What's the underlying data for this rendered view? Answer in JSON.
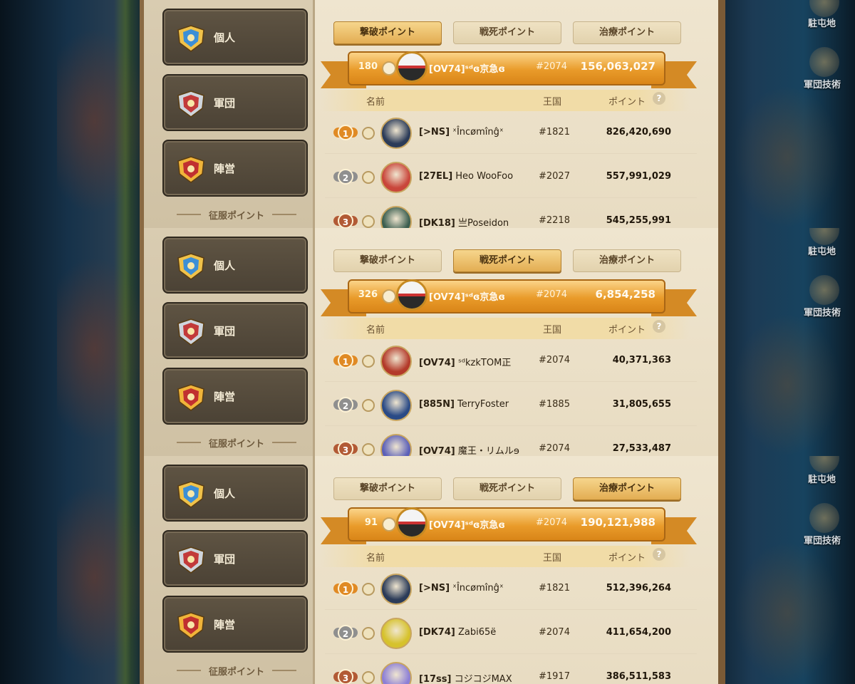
{
  "categories": [
    "個人",
    "軍団",
    "陣営"
  ],
  "conquest_label": "征服ポイント",
  "tabs": [
    "撃破ポイント",
    "戦死ポイント",
    "治療ポイント"
  ],
  "headers": {
    "name": "名前",
    "kingdom": "王国",
    "points": "ポイント",
    "help": "?"
  },
  "side_labels": {
    "camp": "駐屯地",
    "tech": "軍団技術"
  },
  "colors": {
    "gold": "#e99b2a",
    "silver": "#9a9a9a",
    "bronze": "#b25a35",
    "active_tab": "#e3ad52"
  },
  "panels": [
    {
      "active_tab": 0,
      "self": {
        "rank": "180",
        "name": "[OV74]ˢᵈɞ京急ɞ",
        "kingdom": "#2074",
        "points": "156,063,027"
      },
      "rows": [
        {
          "rank": "1",
          "tag": "[>NS]",
          "player": "ˣÎncømînĝˣ",
          "kingdom": "#1821",
          "points": "826,420,690",
          "avatar_color": "#2b3b58"
        },
        {
          "rank": "2",
          "tag": "[27EL]",
          "player": "Heo WooFoo",
          "kingdom": "#2027",
          "points": "557,991,029",
          "avatar_color": "#c9463b"
        },
        {
          "rank": "3",
          "tag": "[DK18]",
          "player": "亗Poseidon",
          "kingdom": "#2218",
          "points": "545,255,991",
          "avatar_color": "#3b5e4f"
        }
      ]
    },
    {
      "active_tab": 1,
      "self": {
        "rank": "326",
        "name": "[OV74]ˢᵈɞ京急ɞ",
        "kingdom": "#2074",
        "points": "6,854,258"
      },
      "rows": [
        {
          "rank": "1",
          "tag": "[OV74]",
          "player": "ˢᵈkzkTOM正",
          "kingdom": "#2074",
          "points": "40,371,363",
          "avatar_color": "#b33a2a"
        },
        {
          "rank": "2",
          "tag": "[885N]",
          "player": "TerryFoster",
          "kingdom": "#1885",
          "points": "31,805,655",
          "avatar_color": "#2a4a86"
        },
        {
          "rank": "3",
          "tag": "[OV74]",
          "player": "魔王・リムルɘ",
          "kingdom": "#2074",
          "points": "27,533,487",
          "avatar_color": "#5a5fb8"
        }
      ]
    },
    {
      "active_tab": 2,
      "self": {
        "rank": "91",
        "name": "[OV74]ˢᵈɞ京急ɞ",
        "kingdom": "#2074",
        "points": "190,121,988"
      },
      "rows": [
        {
          "rank": "1",
          "tag": "[>NS]",
          "player": "ˣÎncømînĝˣ",
          "kingdom": "#1821",
          "points": "512,396,264",
          "avatar_color": "#2b3b58"
        },
        {
          "rank": "2",
          "tag": "[DK74]",
          "player": "Zabi65ë",
          "kingdom": "#2074",
          "points": "411,654,200",
          "avatar_color": "#d6c22c"
        },
        {
          "rank": "3",
          "tag": "[17ss]",
          "player": "コジコジMAX",
          "kingdom": "#1917",
          "points": "386,511,583",
          "avatar_color": "#8c7fd6"
        }
      ]
    }
  ]
}
